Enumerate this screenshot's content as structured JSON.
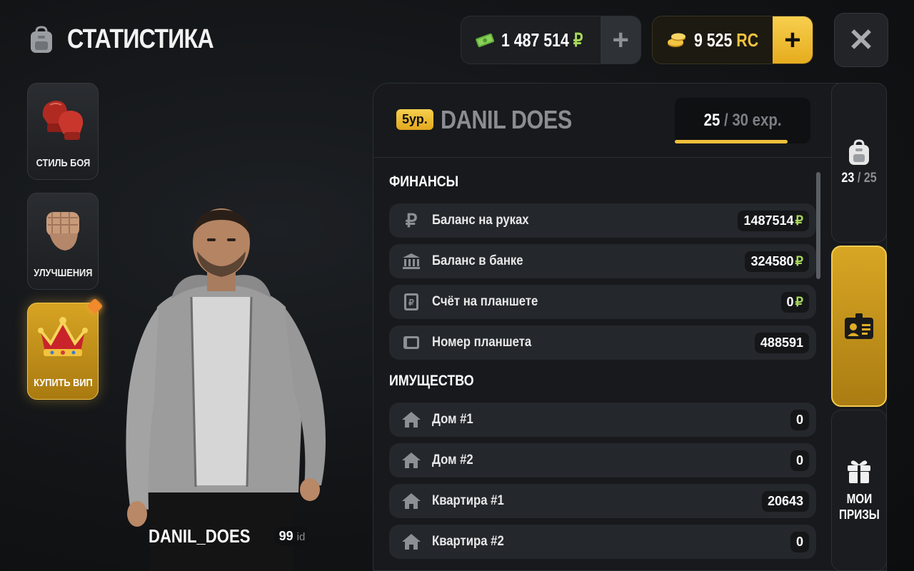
{
  "header": {
    "title": "СТАТИСТИКА",
    "cash": {
      "amount": "1 487 514",
      "currency": "₽",
      "add": "+"
    },
    "rc": {
      "amount": "9 525",
      "currency": "RC",
      "add": "+"
    },
    "close": "✕"
  },
  "side_menu": [
    {
      "label": "СТИЛЬ БОЯ"
    },
    {
      "label": "УЛУЧШЕНИЯ"
    },
    {
      "label": "КУПИТЬ ВИП"
    }
  ],
  "player": {
    "name": "DANIL_DOES",
    "id_num": "99",
    "id_suffix": "id"
  },
  "profile": {
    "level": "5ур.",
    "name": "DANIL DOES",
    "exp_current": "25",
    "exp_sep": " / ",
    "exp_total": "30 exp.",
    "exp_fraction": 0.83
  },
  "finances": {
    "title": "ФИНАНСЫ",
    "rows": [
      {
        "label": "Баланс на руках",
        "value": "1487514",
        "currency": "₽"
      },
      {
        "label": "Баланс в банке",
        "value": "324580",
        "currency": "₽"
      },
      {
        "label": "Счёт на планшете",
        "value": "0",
        "currency": "₽"
      },
      {
        "label": "Номер планшета",
        "value": "488591",
        "currency": ""
      }
    ]
  },
  "property": {
    "title": "ИМУЩЕСТВО",
    "rows": [
      {
        "label": "Дом #1",
        "value": "0"
      },
      {
        "label": "Дом #2",
        "value": "0"
      },
      {
        "label": "Квартира #1",
        "value": "20643"
      },
      {
        "label": "Квартира #2",
        "value": "0"
      }
    ]
  },
  "tabs": {
    "inventory": {
      "count": "23",
      "sep": " / ",
      "max": "25"
    },
    "prizes": {
      "line1": "МОИ",
      "line2": "ПРИЗЫ"
    }
  },
  "colors": {
    "accent_gold": "#f0c03a",
    "ruble_green": "#a7d95a",
    "bg": "#121416"
  }
}
